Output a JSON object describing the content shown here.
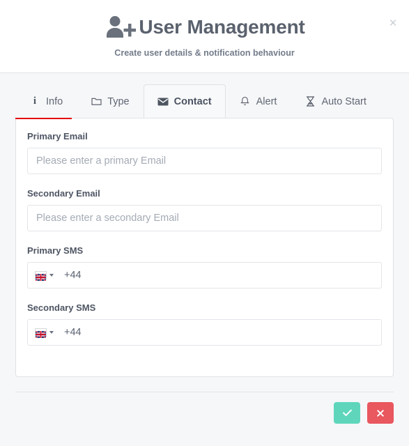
{
  "header": {
    "title": "User Management",
    "subtitle": "Create user details & notification behaviour",
    "icon": "user-plus-icon",
    "close_label": "×"
  },
  "tabs": [
    {
      "label": "Info",
      "icon": "info-icon",
      "active": false
    },
    {
      "label": "Type",
      "icon": "folder-icon",
      "active": false
    },
    {
      "label": "Contact",
      "icon": "envelope-icon",
      "active": true
    },
    {
      "label": "Alert",
      "icon": "bell-icon",
      "active": false
    },
    {
      "label": "Auto Start",
      "icon": "hourglass-icon",
      "active": false
    }
  ],
  "progress": {
    "percent": 15,
    "color": "#e40000"
  },
  "form": {
    "fields": [
      {
        "name": "primary-email",
        "label": "Primary Email",
        "placeholder": "Please enter a primary Email",
        "value": "",
        "type": "email"
      },
      {
        "name": "secondary-email",
        "label": "Secondary Email",
        "placeholder": "Please enter a secondary Email",
        "value": "",
        "type": "email"
      },
      {
        "name": "primary-sms",
        "label": "Primary SMS",
        "placeholder": "",
        "value": "",
        "type": "phone",
        "country": "United Kingdom",
        "flag": "uk-flag-icon",
        "dial_code": "+44"
      },
      {
        "name": "secondary-sms",
        "label": "Secondary SMS",
        "placeholder": "",
        "value": "",
        "type": "phone",
        "country": "United Kingdom",
        "flag": "uk-flag-icon",
        "dial_code": "+44"
      }
    ]
  },
  "footer": {
    "confirm": {
      "label": "✓",
      "icon": "check-icon",
      "color": "#5fd6bc"
    },
    "cancel": {
      "label": "✕",
      "icon": "close-icon",
      "color": "#e9575f"
    }
  }
}
